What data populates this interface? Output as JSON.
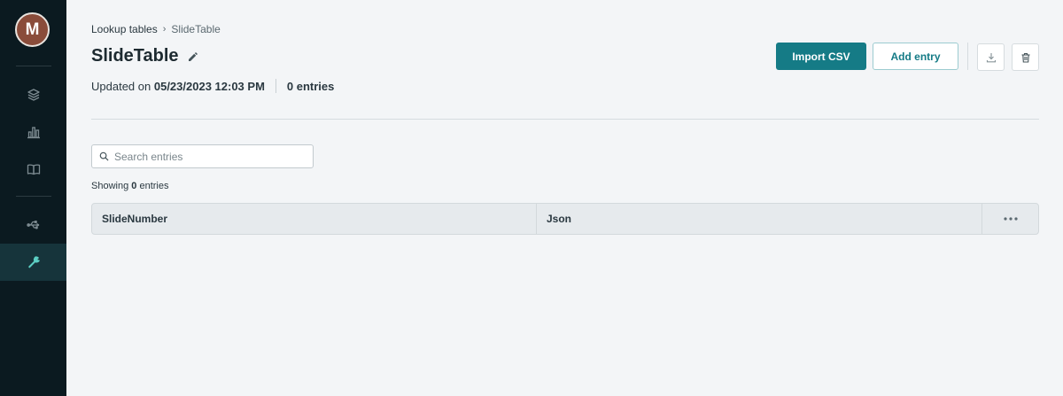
{
  "user": {
    "avatar_initial": "M"
  },
  "sidebar": {
    "items": [
      {
        "name": "layers",
        "icon": "layers-icon"
      },
      {
        "name": "analytics",
        "icon": "bar-chart-icon"
      },
      {
        "name": "docs",
        "icon": "book-icon"
      },
      {
        "name": "integrations",
        "icon": "usb-icon"
      },
      {
        "name": "tools",
        "icon": "wrench-icon",
        "active": true
      }
    ]
  },
  "breadcrumb": {
    "parent": "Lookup tables",
    "separator": "›",
    "current": "SlideTable"
  },
  "page": {
    "title": "SlideTable",
    "updated_prefix": "Updated on",
    "updated_date": "05/23/2023 12:03 PM",
    "entries_count": "0 entries"
  },
  "toolbar": {
    "import_label": "Import CSV",
    "add_label": "Add entry",
    "download_icon": "download-icon",
    "delete_icon": "trash-icon"
  },
  "search": {
    "placeholder": "Search entries",
    "value": ""
  },
  "showing": {
    "prefix": "Showing",
    "count": "0",
    "suffix": "entries"
  },
  "table": {
    "columns": [
      "SlideNumber",
      "Json"
    ],
    "rows": [],
    "more_icon": "more-horizontal-icon"
  },
  "colors": {
    "accent": "#157b86",
    "sidebar_bg": "#0b1a20",
    "page_bg": "#f3f5f7",
    "active_icon": "#5ccfc4"
  }
}
